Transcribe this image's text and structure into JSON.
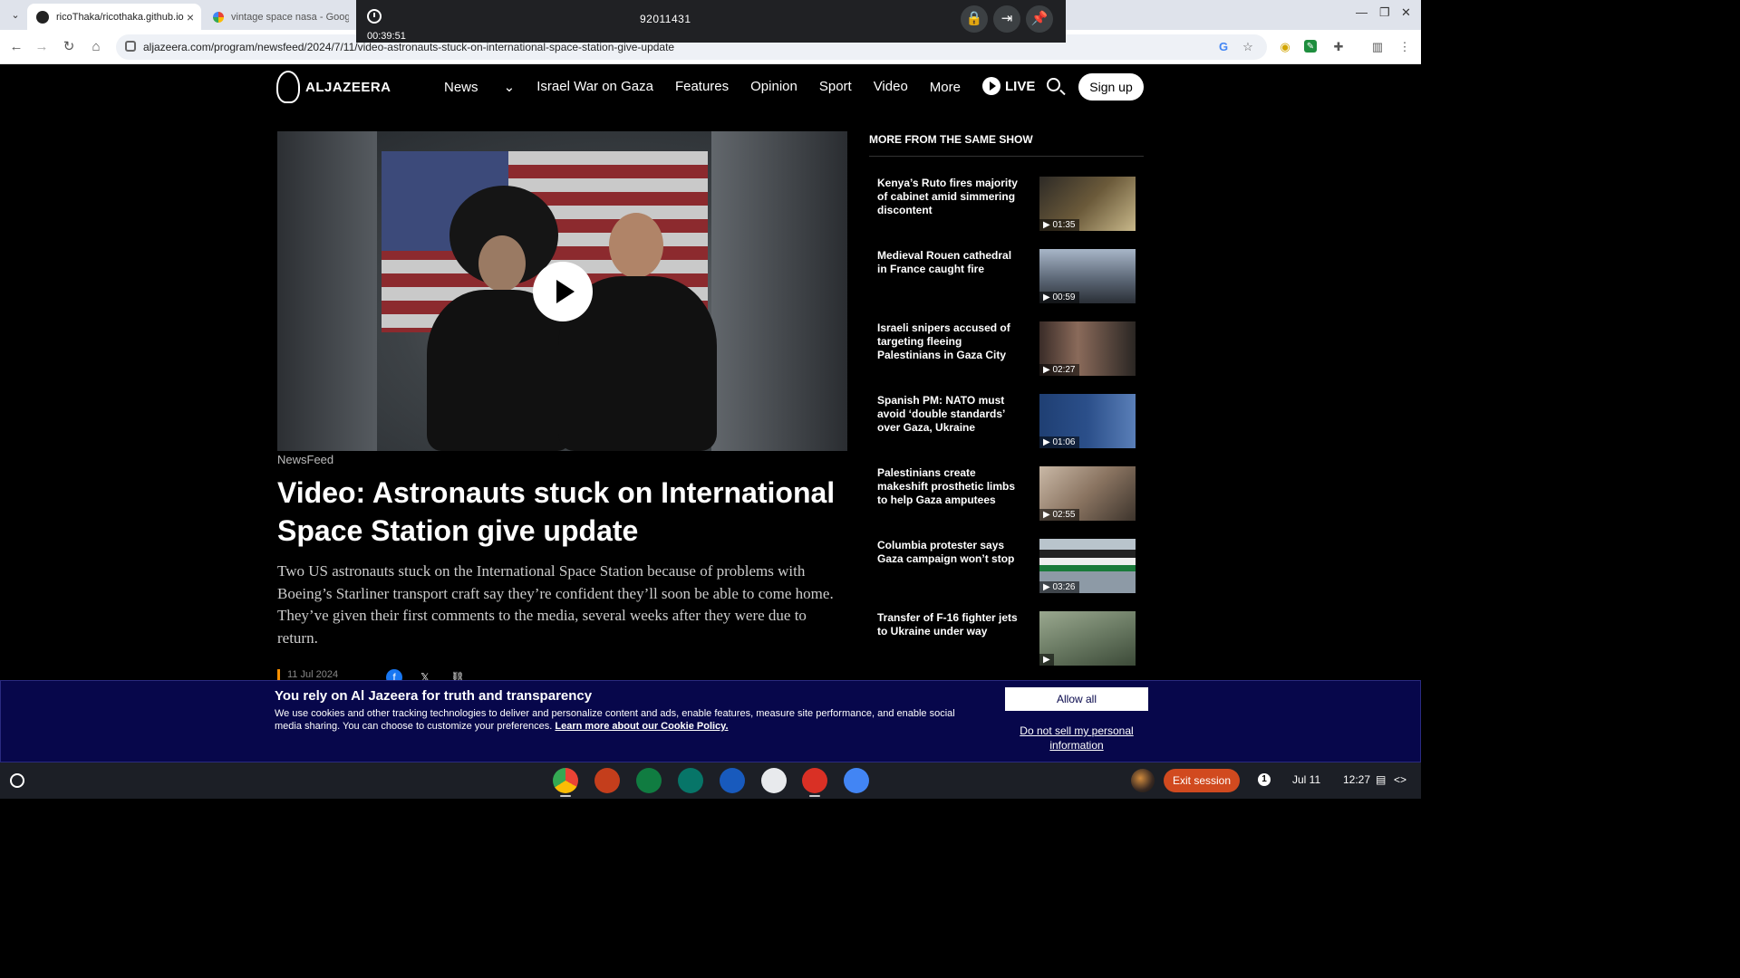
{
  "browser": {
    "tabs": [
      {
        "title": "ricoThaka/ricothaka.github.io",
        "active": true
      },
      {
        "title": "vintage space nasa - Google Se",
        "active": false
      }
    ],
    "url": "aljazeera.com/program/newsfeed/2024/7/11/video-astronauts-stuck-on-international-space-station-give-update",
    "new_tab_symbol": "+"
  },
  "recorder": {
    "elapsed": "00:39:51",
    "session_id": "92011431"
  },
  "site": {
    "logo": "ALJAZEERA",
    "nav": [
      "News",
      "Israel War on Gaza",
      "Features",
      "Opinion",
      "Sport",
      "Video",
      "More"
    ],
    "live_label": "LIVE",
    "signup_label": "Sign up"
  },
  "article": {
    "kicker": "NewsFeed",
    "headline": "Video: Astronauts stuck on International Space Station give update",
    "summary": "Two US astronauts stuck on the International Space Station because of problems with Boeing’s Starliner transport craft say they’re confident they’ll soon be able to come home. They’ve given their first comments to the media, several weeks after they were due to return.",
    "date": "11 Jul 2024"
  },
  "sidebar": {
    "title": "MORE FROM THE SAME SHOW",
    "items": [
      {
        "title": "Kenya’s Ruto fires majority of cabinet amid simmering discontent",
        "duration": "01:35",
        "thumb_color": "#6b5a3a"
      },
      {
        "title": "Medieval Rouen cathedral in France caught fire",
        "duration": "00:59",
        "thumb_color": "#5d6877"
      },
      {
        "title": "Israeli snipers accused of target­ing fleeing Palestinians in Gaza City",
        "duration": "02:27",
        "thumb_color": "#4a3f3a"
      },
      {
        "title": "Spanish PM: NATO must avoid ‘double standards’ over Gaza, Ukraine",
        "duration": "01:06",
        "thumb_color": "#2b4f8a"
      },
      {
        "title": "Palestinians create makeshift prosthetic limbs to help Gaza amputees",
        "duration": "02:55",
        "thumb_color": "#8a7461"
      },
      {
        "title": "Columbia protester says Gaza campaign won’t stop",
        "duration": "03:26",
        "thumb_color": "#8d9aa6"
      },
      {
        "title": "Transfer of F-16 fighter jets to Ukraine under way",
        "duration": "",
        "thumb_color": "#6a7a63"
      }
    ]
  },
  "cookie": {
    "title": "You rely on Al Jazeera for truth and transparency",
    "text": "We use cookies and other tracking technologies to deliver and personalize content and ads, enable features, measure site performance, and enable social media sharing. You can choose to customize your preferences.",
    "link": "Learn more about our Cookie Policy.",
    "allow": "Allow all",
    "donot": "Do not sell my personal information"
  },
  "shelf": {
    "exit": "Exit session",
    "notifications": "1",
    "date": "Jul 11",
    "time": "12:27"
  }
}
